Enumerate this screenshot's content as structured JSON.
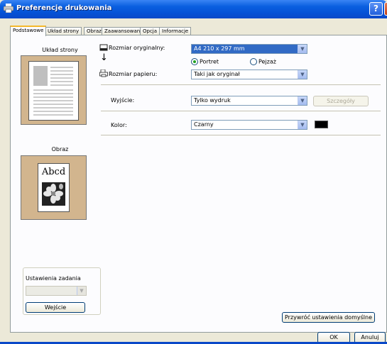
{
  "window": {
    "title": "Preferencje drukowania",
    "help_label": "?",
    "close_label": "X"
  },
  "tabs": [
    {
      "label": "Podstawowe"
    },
    {
      "label": "Układ strony"
    },
    {
      "label": "Obraz"
    },
    {
      "label": "Zaawansowane"
    },
    {
      "label": "Opcja"
    },
    {
      "label": "Informacje"
    }
  ],
  "left": {
    "layout_title": "Układ strony",
    "image_title": "Obraz",
    "image_sample_text": "Abcd",
    "job_settings": {
      "label": "Ustawienia zadania",
      "select_value": "",
      "button_label": "Wejście"
    }
  },
  "form": {
    "original_size": {
      "label": "Rozmiar oryginalny:",
      "value": "A4 210 x 297 mm"
    },
    "orientation": {
      "portrait_label": "Portret",
      "landscape_label": "Pejzaż",
      "selected": "Portret"
    },
    "paper_size": {
      "label": "Rozmiar papieru:",
      "value": "Taki jak oryginał"
    },
    "output": {
      "label": "Wyjście:",
      "value": "Tylko wydruk",
      "details_label": "Szczegóły"
    },
    "color": {
      "label": "Kolor:",
      "value": "Czarny",
      "swatch": "#000000"
    }
  },
  "buttons": {
    "restore_defaults": "Przywróć ustawienia domyślne",
    "ok": "OK",
    "cancel": "Anuluj"
  },
  "icons": {
    "down_arrow": "▼",
    "arrow_down_long": "↓"
  },
  "colors": {
    "titlebar": "#0a5fe0",
    "selection": "#316ac5",
    "preview_bg": "#d2b58e",
    "tab_active": "#f4b82a"
  }
}
